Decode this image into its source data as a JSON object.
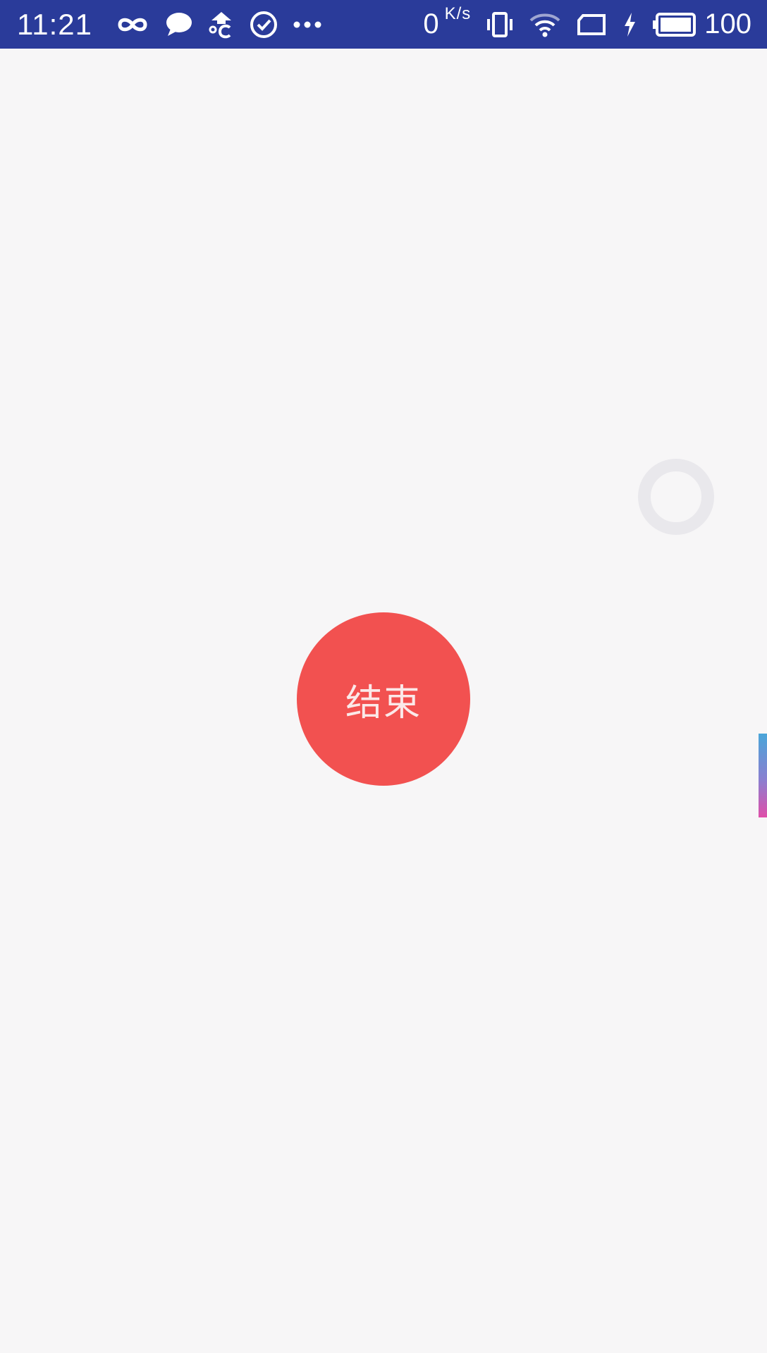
{
  "status_bar": {
    "time": "11:21",
    "icons_left": [
      "infinity-icon",
      "chat-bubble-icon",
      "weather-icon",
      "check-circle-icon",
      "more-dots-icon"
    ],
    "net_speed_value": "0",
    "net_speed_unit": "K/s",
    "icons_right": [
      "vibrate-icon",
      "wifi-icon",
      "sim-card-icon",
      "charging-bolt-icon",
      "battery-icon"
    ],
    "battery_percent": "100",
    "background_color": "#2a3b9a"
  },
  "main": {
    "background_color": "#f7f6f7",
    "end_button": {
      "label": "结束",
      "color": "#f25150",
      "text_color": "#fbe9e9"
    },
    "loading_ring_color": "#e9e8ec"
  }
}
